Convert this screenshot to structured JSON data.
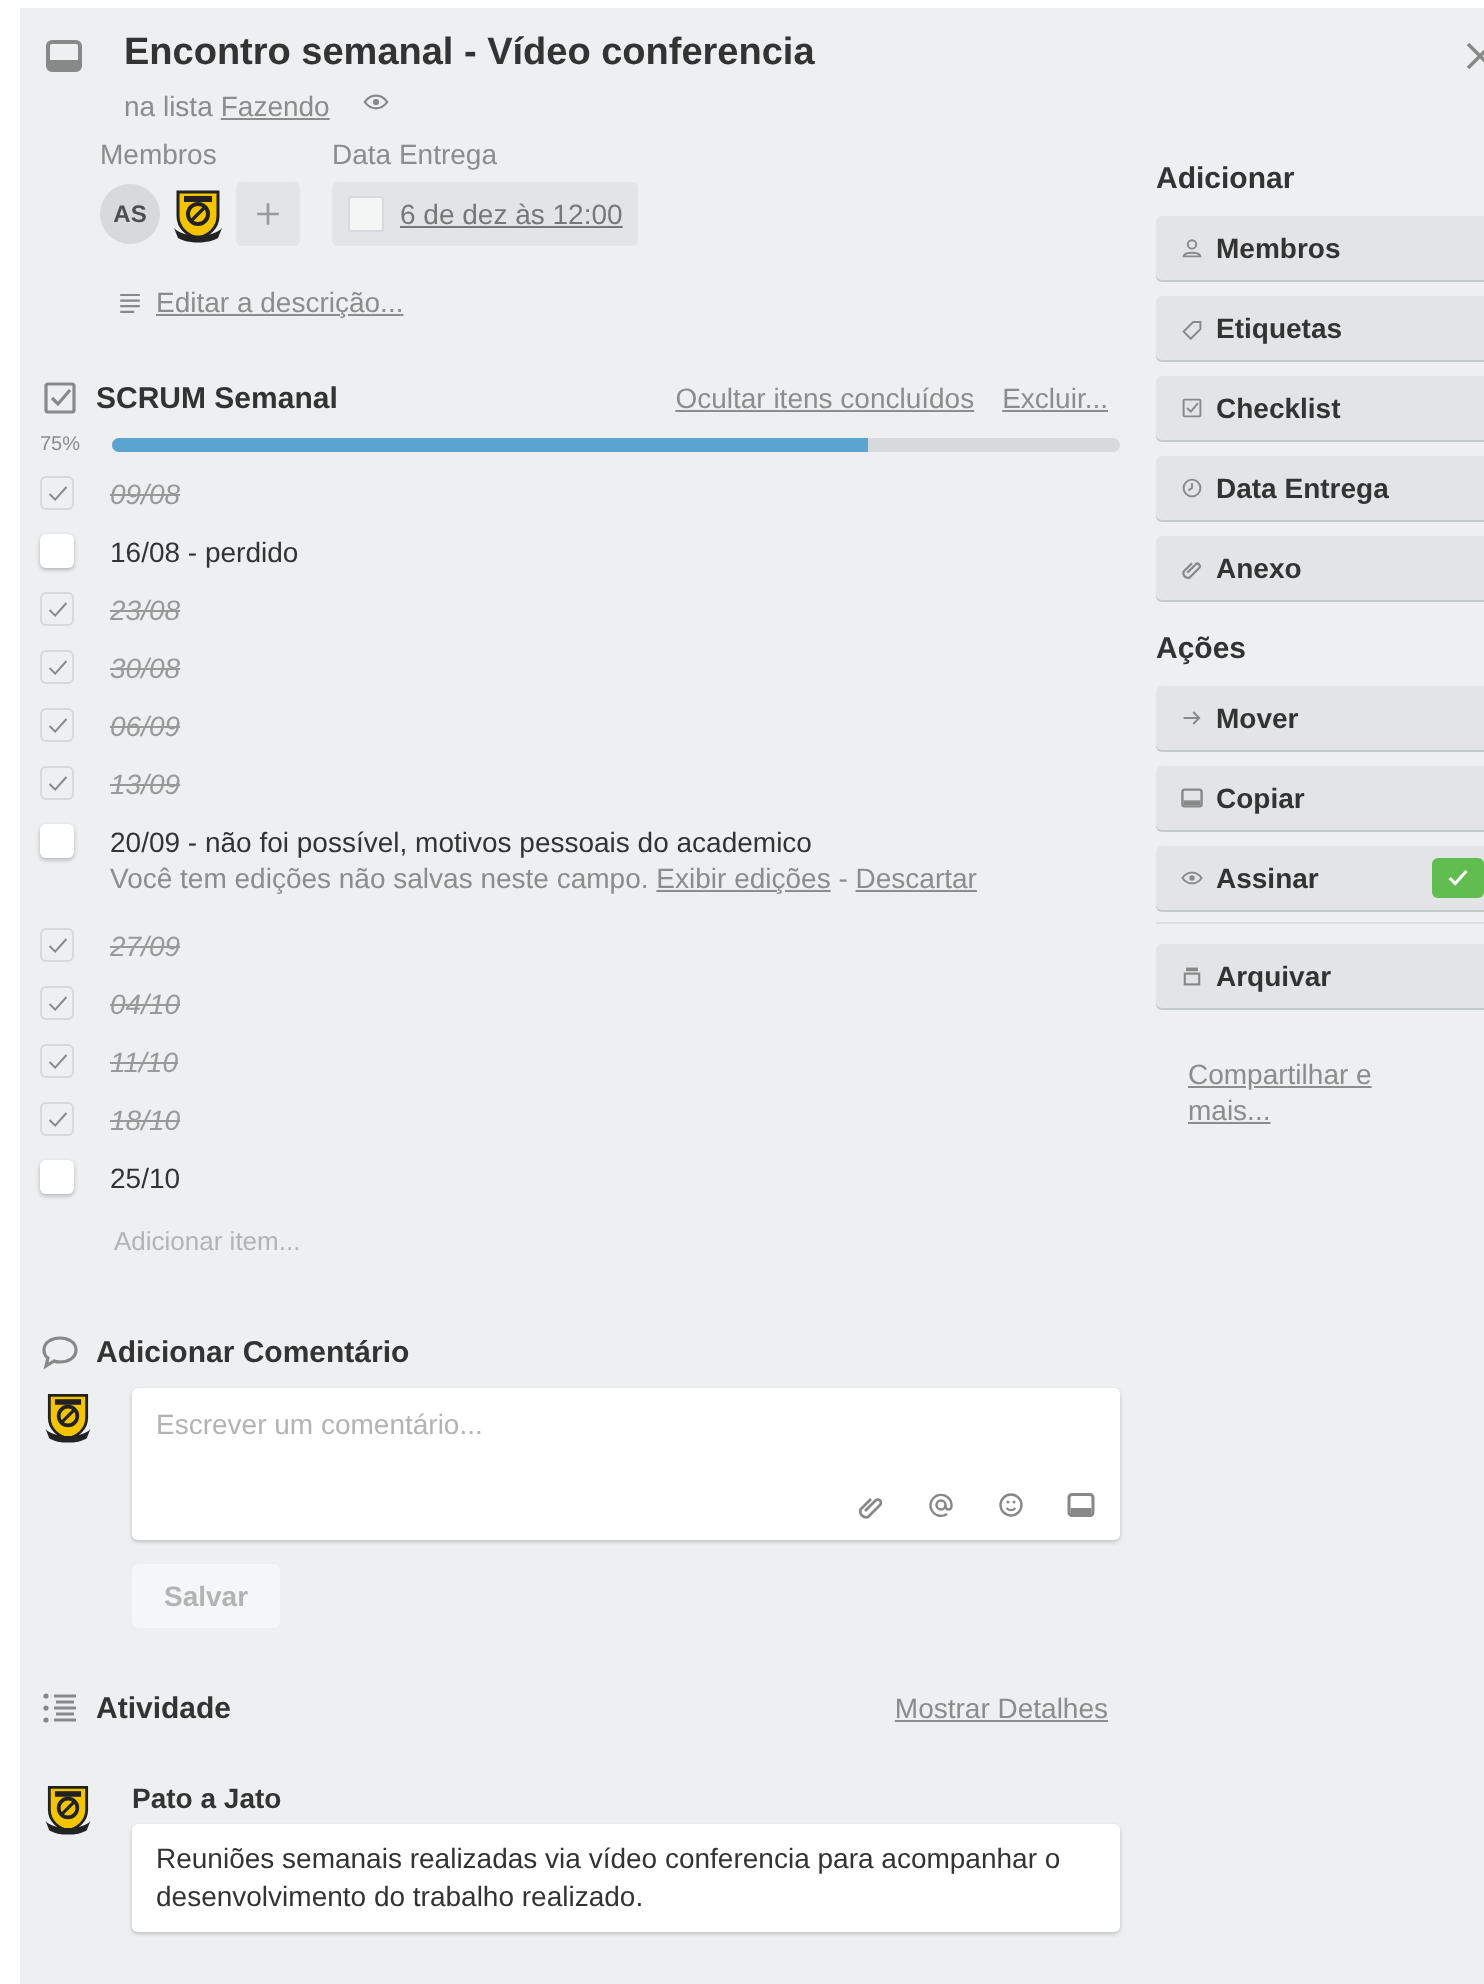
{
  "card": {
    "title": "Encontro semanal - Vídeo conferencia",
    "list_prefix": "na lista",
    "list_name": "Fazendo"
  },
  "members": {
    "label": "Membros",
    "people": [
      {
        "kind": "initials",
        "text": "AS"
      },
      {
        "kind": "badge"
      }
    ]
  },
  "due": {
    "label": "Data Entrega",
    "value": "6 de dez às 12:00",
    "done": false
  },
  "description_link": "Editar a descrição...",
  "checklist": {
    "title": "SCRUM Semanal",
    "hide_link": "Ocultar itens concluídos",
    "delete_link": "Excluir...",
    "percent": "75%",
    "level": 0.75,
    "items": [
      {
        "text": "09/08",
        "checked": true
      },
      {
        "text": "16/08 - perdido",
        "checked": false
      },
      {
        "text": "23/08",
        "checked": true
      },
      {
        "text": "30/08",
        "checked": true
      },
      {
        "text": "06/09",
        "checked": true
      },
      {
        "text": "13/09",
        "checked": true
      },
      {
        "text": "20/09 - não foi possível, motivos pessoais do academico",
        "checked": false,
        "note": {
          "text": "Você tem edições não salvas neste campo.",
          "show_link": "Exibir edições",
          "separator": "-",
          "discard_link": "Descartar"
        }
      },
      {
        "text": "27/09",
        "checked": true
      },
      {
        "text": "04/10",
        "checked": true
      },
      {
        "text": "11/10",
        "checked": true
      },
      {
        "text": "18/10",
        "checked": true
      },
      {
        "text": "25/10",
        "checked": false
      }
    ],
    "add_placeholder": "Adicionar item..."
  },
  "comment": {
    "title": "Adicionar Comentário",
    "placeholder": "Escrever um comentário...",
    "save": "Salvar"
  },
  "activity": {
    "title": "Atividade",
    "details_link": "Mostrar Detalhes",
    "entries": [
      {
        "author": "Pato a Jato",
        "text": "Reuniões semanais realizadas via vídeo conferencia para acompanhar o desenvolvimento do trabalho realizado."
      }
    ]
  },
  "sidebar": {
    "add_title": "Adicionar",
    "add_buttons": [
      {
        "label": "Membros",
        "kind": "person"
      },
      {
        "label": "Etiquetas",
        "kind": "tag"
      },
      {
        "label": "Checklist",
        "kind": "checkbox"
      },
      {
        "label": "Data Entrega",
        "kind": "clock"
      },
      {
        "label": "Anexo",
        "kind": "clip"
      }
    ],
    "actions_title": "Ações",
    "action_buttons": [
      {
        "label": "Mover",
        "kind": "arrow"
      },
      {
        "label": "Copiar",
        "kind": "card"
      },
      {
        "label": "Assinar",
        "kind": "eye",
        "checked": true
      },
      {
        "label": "Arquivar",
        "kind": "archive"
      }
    ],
    "share_link": "Compartilhar e mais..."
  }
}
